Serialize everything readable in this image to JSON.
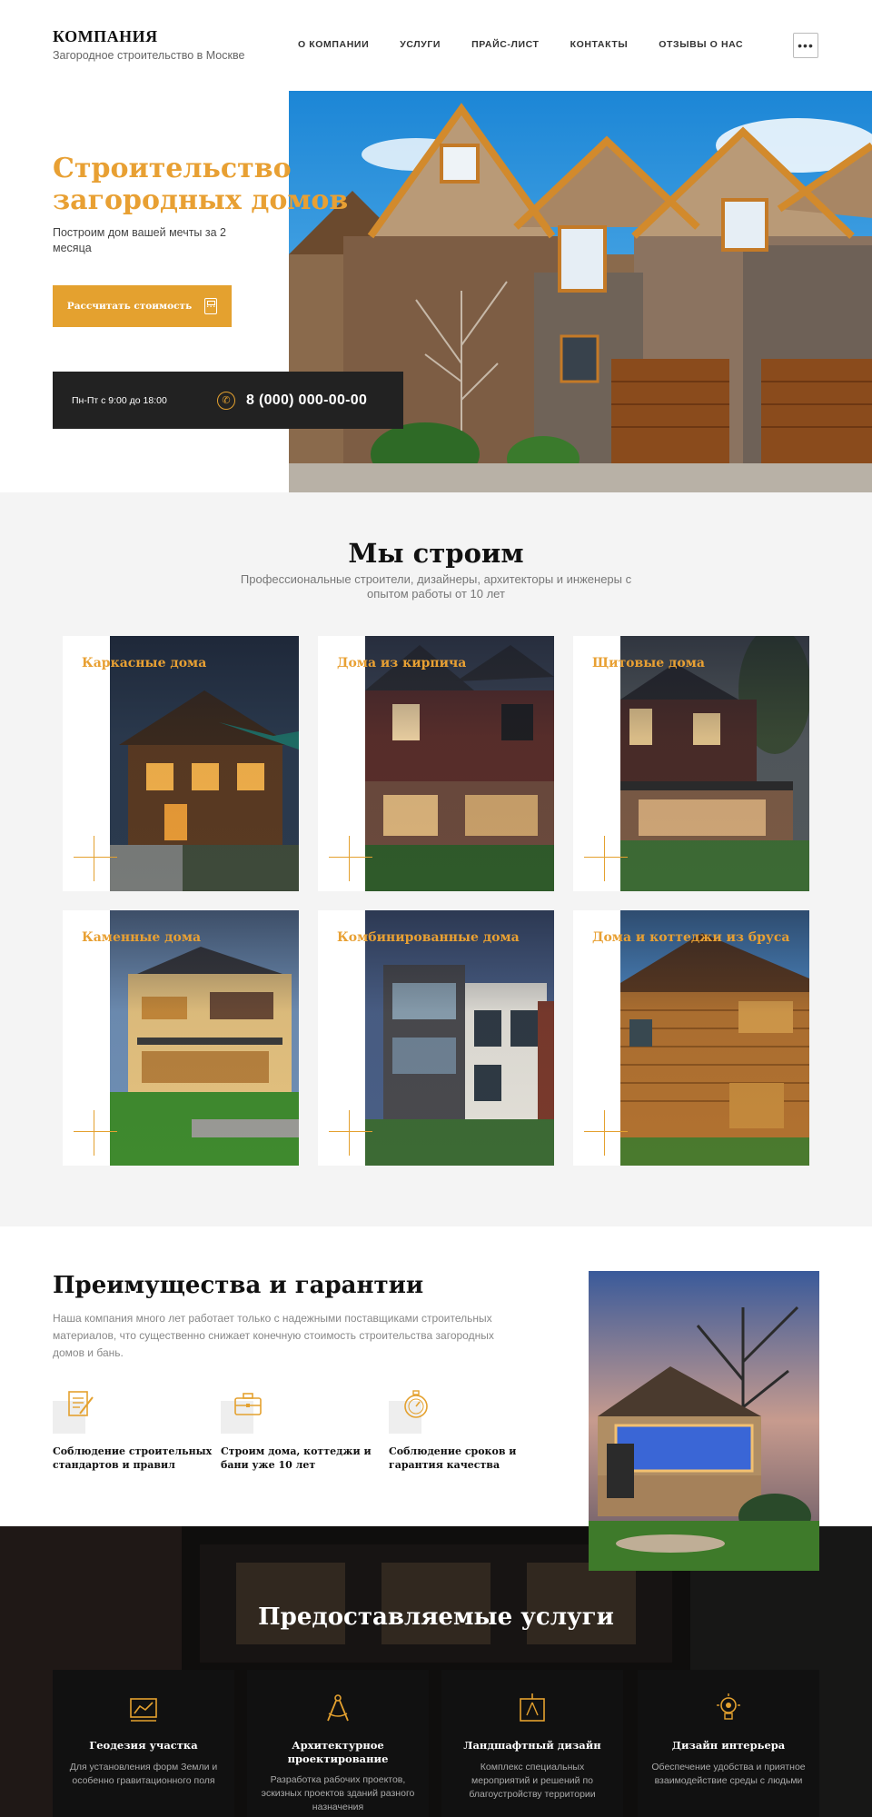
{
  "header": {
    "brand_name": "КОМПАНИЯ",
    "brand_tagline": "Загородное строительство в Москве",
    "nav": [
      "О КОМПАНИИ",
      "УСЛУГИ",
      "ПРАЙС-ЛИСТ",
      "КОНТАКТЫ",
      "ОТЗЫВЫ О НАС"
    ],
    "menu_icon": "ellipsis-icon"
  },
  "hero": {
    "title": "Строительство загородных домов",
    "subtitle": "Построим дом вашей мечты за 2 месяца",
    "cta_label": "Рассчитать стоимость",
    "cta_icon": "calculator-icon",
    "hours": "Пн-Пт с 9:00 до 18:00",
    "phone": "8 (000) 000-00-00",
    "phone_icon": "phone-icon",
    "accent_color": "#e4a12f"
  },
  "build": {
    "title": "Мы строим",
    "subtitle": "Профессиональные строители, дизайнеры, архитекторы и инженеры с опытом работы от 10 лет",
    "cards": [
      {
        "title": "Каркасные дома"
      },
      {
        "title": "Дома из кирпича"
      },
      {
        "title": "Щитовые дома"
      },
      {
        "title": "Каменные дома"
      },
      {
        "title": "Комбинированные дома"
      },
      {
        "title": "Дома и коттеджи из бруса"
      }
    ]
  },
  "advantages": {
    "title": "Преимущества и гарантии",
    "text": "Наша компания много лет работает только с надежными поставщиками строительных материалов, что существенно снижает конечную стоимость строительства загородных домов и бань.",
    "items": [
      {
        "label": "Соблюдение строительных стандартов и правил",
        "icon": "document-pen-icon"
      },
      {
        "label": "Строим дома, коттеджи и бани уже 10 лет",
        "icon": "briefcase-icon"
      },
      {
        "label": "Соблюдение сроков и гарантия качества",
        "icon": "stopwatch-icon"
      }
    ]
  },
  "services": {
    "title": "Предоставляемые услуги",
    "items": [
      {
        "title": "Геодезия участка",
        "desc": "Для установления форм Земли и особенно гравитационного поля",
        "icon": "surveying-icon"
      },
      {
        "title": "Архитектурное проектирование",
        "desc": "Разработка рабочих проектов, эскизных проектов зданий разного назначения",
        "icon": "compass-icon"
      },
      {
        "title": "Ландшафтный дизайн",
        "desc": "Комплекс специальных мероприятий и решений по благоустройству территории",
        "icon": "blueprint-icon"
      },
      {
        "title": "Дизайн интерьера",
        "desc": "Обеспечение удобства и приятное взаимодействие среды с людьми",
        "icon": "lightbulb-icon"
      }
    ]
  }
}
